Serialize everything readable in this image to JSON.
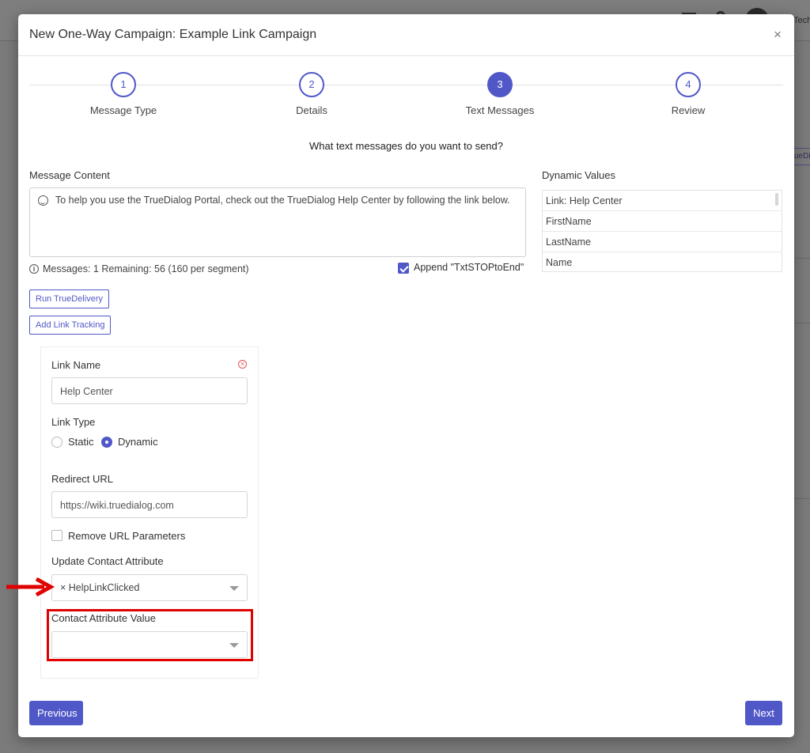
{
  "background": {
    "user_text": "Tech",
    "chip_text": "ueDi"
  },
  "modal": {
    "title": "New One-Way Campaign: Example Link Campaign",
    "close_glyph": "×"
  },
  "stepper": {
    "steps": [
      {
        "number": "1",
        "label": "Message Type"
      },
      {
        "number": "2",
        "label": "Details"
      },
      {
        "number": "3",
        "label": "Text Messages"
      },
      {
        "number": "4",
        "label": "Review"
      }
    ],
    "active_step": 3
  },
  "prompt": "What text messages do you want to send?",
  "message": {
    "label": "Message Content",
    "text": "To help you use the TrueDialog Portal, check out the TrueDialog Help Center by following the link below.",
    "counter": "Messages: 1 Remaining: 56 (160 per segment)",
    "append_label": "Append \"TxtSTOPtoEnd\"",
    "append_checked": true
  },
  "dynamic_values": {
    "label": "Dynamic Values",
    "items": [
      "Link: Help Center",
      "FirstName",
      "LastName",
      "Name"
    ]
  },
  "actions": {
    "run_truedelivery": "Run TrueDelivery",
    "add_link_tracking": "Add Link Tracking"
  },
  "link_tracking": {
    "link_name_label": "Link Name",
    "link_name_value": "Help Center",
    "link_type_label": "Link Type",
    "static_label": "Static",
    "dynamic_label": "Dynamic",
    "selected_type": "Dynamic",
    "redirect_url_label": "Redirect URL",
    "redirect_url_value": "https://wiki.truedialog.com",
    "remove_params_label": "Remove URL Parameters",
    "remove_params_checked": false,
    "update_attr_label": "Update Contact Attribute",
    "update_attr_value": "× HelpLinkClicked",
    "attr_value_label": "Contact Attribute Value",
    "attr_value_value": ""
  },
  "footer": {
    "previous": "Previous",
    "next": "Next"
  },
  "colors": {
    "accent": "#5058c8",
    "highlight": "#e00000",
    "remove": "#e05555"
  }
}
